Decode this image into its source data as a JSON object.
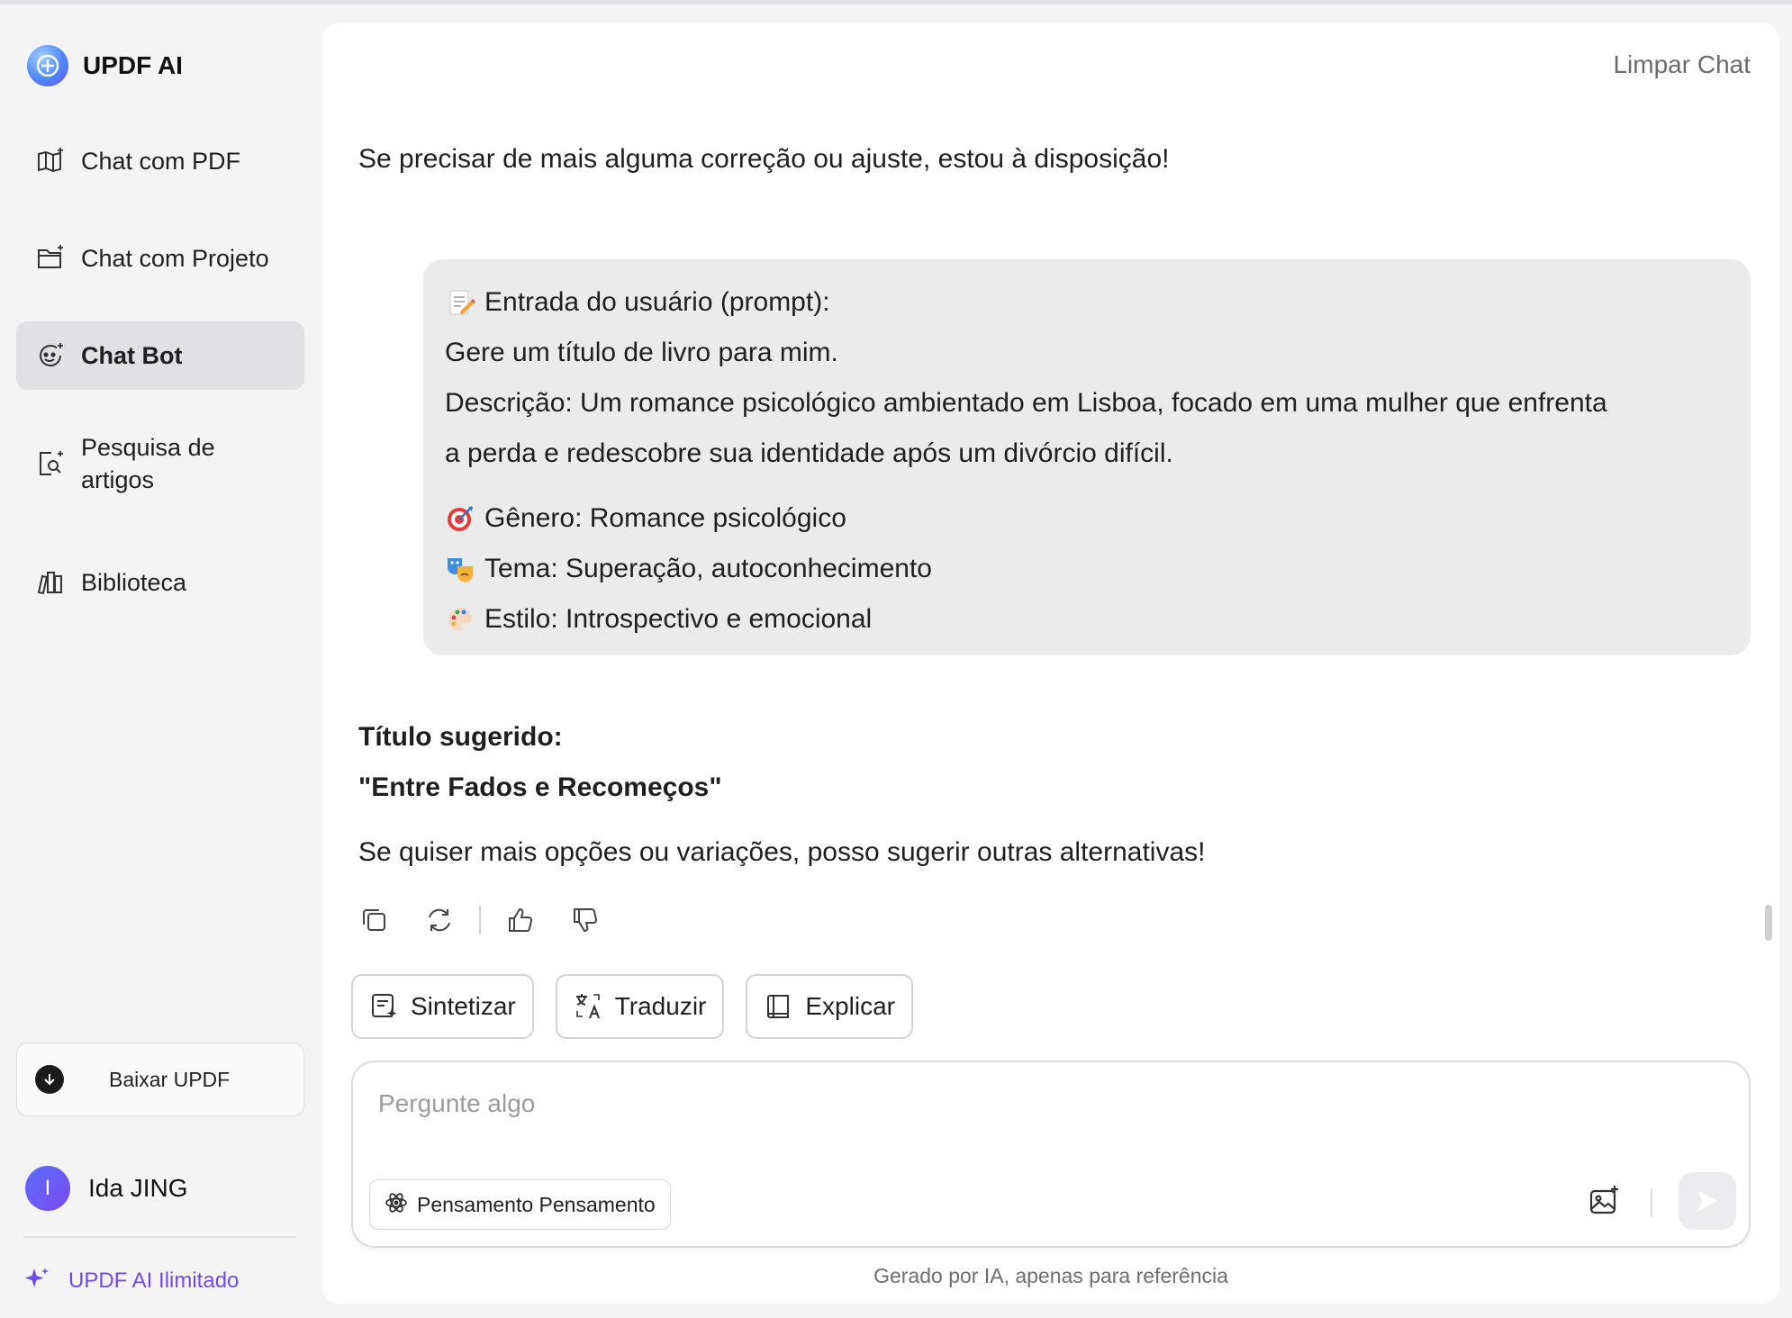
{
  "brand": {
    "name": "UPDF AI"
  },
  "sidebar": {
    "items": [
      {
        "label": "Chat com PDF",
        "icon": "book-sparkle-icon"
      },
      {
        "label": "Chat com Projeto",
        "icon": "folder-sparkle-icon"
      },
      {
        "label": "Chat Bot",
        "icon": "bot-icon",
        "active": true
      },
      {
        "label": "Pesquisa de artigos",
        "icon": "article-search-icon"
      },
      {
        "label": "Biblioteca",
        "icon": "library-icon"
      }
    ],
    "download_label": "Baixar UPDF",
    "user": {
      "initial": "I",
      "name": "Ida JING"
    },
    "upgrade_label": "UPDF AI Ilimitado"
  },
  "header": {
    "clear_chat": "Limpar Chat"
  },
  "chat": {
    "prev_reply_tail": "Se precisar de mais alguma correção ou ajuste, estou à disposição!",
    "user_prompt": {
      "heading": "Entrada do usuário (prompt):",
      "line1": "Gere um título de livro para mim.",
      "line2": "Descrição: Um romance psicológico ambientado em Lisboa, focado em uma mulher que enfrenta",
      "line3": "a perda e redescobre sua identidade após um divórcio difícil.",
      "genre": "Gênero: Romance psicológico",
      "theme": "Tema: Superação, autoconhecimento",
      "style": "Estilo: Introspectivo e emocional"
    },
    "reply": {
      "label": "Título sugerido:",
      "title": "\"Entre Fados e Recomeços\"",
      "follow_up": "Se quiser mais opções ou variações, posso sugerir outras alternativas!"
    }
  },
  "quick_actions": [
    {
      "label": "Sintetizar",
      "icon": "summarize-icon"
    },
    {
      "label": "Traduzir",
      "icon": "translate-icon"
    },
    {
      "label": "Explicar",
      "icon": "explain-book-icon"
    }
  ],
  "input": {
    "placeholder": "Pergunte algo",
    "value": "",
    "thinking_label": "Pensamento Pensamento"
  },
  "footer_note": "Gerado por IA, apenas para referência",
  "colors": {
    "accent": "#6f4de6",
    "active_bg": "#e1e1e3",
    "bubble_bg": "#ebebec"
  }
}
